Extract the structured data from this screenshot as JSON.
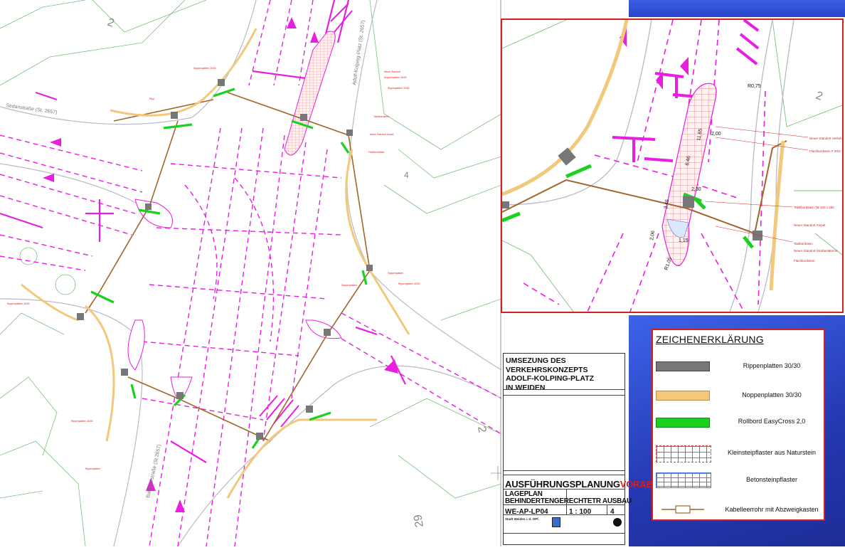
{
  "plan": {
    "street_labels": [
      "Sedanstraße (St. 2657)",
      "Bahnhofstraße (St 2657)",
      "Adolf-Kolping-Platz (St. 2657)"
    ],
    "plot_numbers": [
      "2",
      "4",
      "2",
      "29"
    ]
  },
  "detail": {
    "dimensions": [
      "R0,75",
      "11,65",
      "2,00",
      "6,46",
      "2,30",
      "3,45",
      "2,06",
      "1,15",
      "R1,05"
    ],
    "annotations": [
      "Neuer Standort Verkehrsampel",
      "Flachbordstein F 20/2",
      "Taktilbordstein TB 100 x 260",
      "Neuer Standort Ampel",
      "Tastbordstein",
      "Neuer Standort Straßenlaterne",
      "Flachbordstein"
    ]
  },
  "titleblock": {
    "project_lines": [
      "UMSEZUNG DES VERKEHRSKONZEPTS",
      "ADOLF-KOLPING-PLATZ",
      "IN WEIDEN"
    ],
    "phase_main": "AUSFÜHRUNGSPLANUNG",
    "phase_flag": "VORABZUG",
    "plan_lines": [
      "LAGEPLAN",
      "BEHINDERTENGERECHTETR AUSBAU"
    ],
    "plan_number": "WE-AP-LP04",
    "scale": "1 : 100",
    "sheet": "4",
    "client": "Stadt Weiden i. d. OPf."
  },
  "legend": {
    "title": "ZEICHENERKLÄRUNG",
    "items": [
      {
        "label": "Rippenplatten 30/30",
        "swatch": "grey",
        "color": "#777777"
      },
      {
        "label": "Noppenplatten 30/30",
        "swatch": "orange",
        "color": "#f2c87a"
      },
      {
        "label": "Rollbord EasyCross 2,0",
        "swatch": "green",
        "color": "#19d11e"
      },
      {
        "label": "Kleinsteipflaster aus Naturstein",
        "swatch": "redgrid",
        "color": "#e64040"
      },
      {
        "label": "Betonsteinpflaster",
        "swatch": "bluegrid",
        "color": "#4a7bd0"
      },
      {
        "label": "Kabelleerrohr mit Abzweigkasten",
        "swatch": "cable",
        "color": "#a0662a"
      }
    ]
  },
  "colors": {
    "marking": "#e81ee0",
    "border": "#d12020",
    "cable": "#a0662a",
    "building": "#8fc48f"
  }
}
